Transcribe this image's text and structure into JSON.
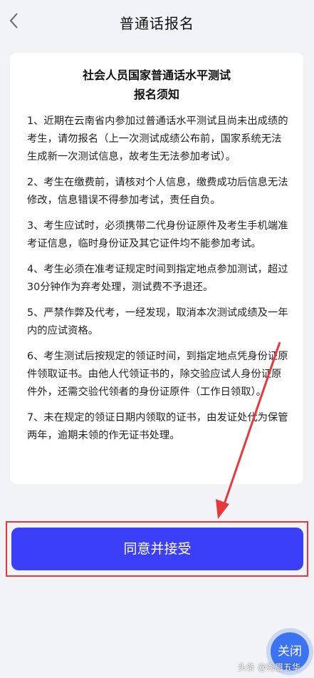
{
  "header": {
    "title": "普通话报名",
    "back_icon": "chevron-left-icon"
  },
  "card": {
    "title_line1": "社会人员国家普通话水平测试",
    "title_line2": "报名须知",
    "notices": [
      "1、近期在云南省内参加过普通话水平测试且尚未出成绩的考生，请勿报名（上一次测试成绩公布前，国家系统无法生成新一次测试信息，故考生无法参加考试）。",
      "2、考生在缴费前，请核对个人信息，缴费成功后信息无法修改，信息错误不得参加考试，责任自负。",
      "3、考生应试时，必须携带二代身份证原件及考生手机端准考证信息，临时身份证及其它证件均不能参加考试。",
      "4、考生必须在准考证规定时间到指定地点参加测试，超过30分钟作为弃考处理，测试费不予退还。",
      "5、严禁作弊及代考，一经发现，取消本次测试成绩及一年内的应试资格。",
      "6、考生测试后按规定的领证时间，到指定地点凭身份证原件领取证书。由他人代领证书的，除交验应试人身份证原件外，还需交验代领者的身份证原件（工作日领取）。",
      "7、未在规定的领证日期内领取的证书，由发证处代为保管两年，逾期未领的作无证书处理。"
    ]
  },
  "actions": {
    "agree_label": "同意并接受",
    "close_label": "关闭"
  },
  "watermark": "头条 @秀眉五华",
  "colors": {
    "primary_button": "#3b3ff8",
    "annotation_red": "#e8383a",
    "close_button": "#3b73f0",
    "background": "#f2f3f7"
  }
}
